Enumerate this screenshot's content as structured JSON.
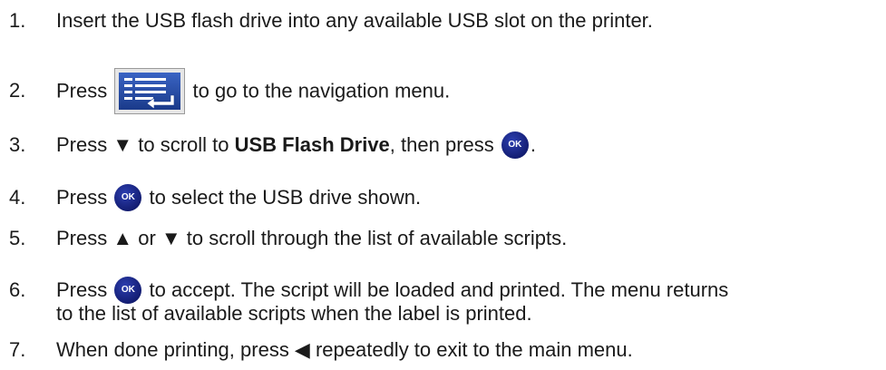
{
  "steps": [
    {
      "num": "1.",
      "text": "Insert the USB flash drive into any available USB slot on the printer."
    },
    {
      "num": "2.",
      "text_before": "Press",
      "text_after": "to go to the navigation menu.",
      "icon": "navigation-menu-icon"
    },
    {
      "num": "3.",
      "text_before": "Press ▼ to scroll to",
      "bold": "USB Flash Drive",
      "text_mid": ", then press",
      "text_after": ".",
      "icon": "ok-button-icon"
    },
    {
      "num": "4.",
      "text_before": "Press",
      "text_after": "to select the USB drive shown.",
      "icon": "ok-button-icon"
    },
    {
      "num": "5.",
      "text": "Press ▲ or ▼ to scroll through the list of available scripts."
    },
    {
      "num": "6.",
      "text_before": "Press",
      "text_after": "to accept. The script will be loaded and printed. The menu returns",
      "line2": "to the list of available scripts when the label is printed.",
      "icon": "ok-button-icon"
    },
    {
      "num": "7.",
      "text": "When done printing, press ◀ repeatedly to exit to the main menu."
    }
  ],
  "ok_label": "OK",
  "colors": {
    "ok_button": "#131d73",
    "nav_icon": "#1f3c8f",
    "text": "#1a1a1a"
  }
}
